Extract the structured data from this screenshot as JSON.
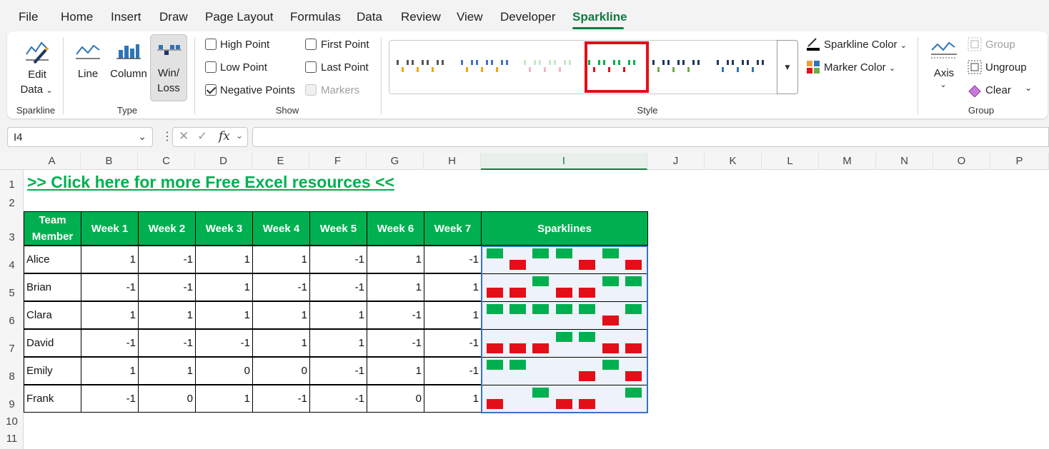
{
  "menu": {
    "tabs": [
      "File",
      "Home",
      "Insert",
      "Draw",
      "Page Layout",
      "Formulas",
      "Data",
      "Review",
      "View",
      "Developer",
      "Sparkline"
    ],
    "active": "Sparkline"
  },
  "ribbon": {
    "sparkline_group": {
      "label": "Sparkline",
      "edit_data_line1": "Edit",
      "edit_data_line2": "Data"
    },
    "type_group": {
      "label": "Type",
      "line": "Line",
      "column": "Column",
      "winloss_line1": "Win/",
      "winloss_line2": "Loss",
      "selected": "Win/Loss"
    },
    "show_group": {
      "label": "Show",
      "high_point": "High Point",
      "low_point": "Low Point",
      "negative_points": "Negative Points",
      "first_point": "First Point",
      "last_point": "Last Point",
      "markers": "Markers",
      "checked": {
        "high_point": false,
        "low_point": false,
        "negative_points": true,
        "first_point": false,
        "last_point": false,
        "markers": false
      }
    },
    "style_group": {
      "label": "Style",
      "sparkline_color": "Sparkline Color",
      "marker_color": "Marker Color",
      "swatches": [
        {
          "main": "#595959",
          "neg": "#f2a900"
        },
        {
          "main": "#4472c4",
          "neg": "#f2a900"
        },
        {
          "main": "#c6e8c6",
          "neg": "#f4b6c2"
        },
        {
          "main": "#00b050",
          "neg": "#e30f18"
        },
        {
          "main": "#1f3864",
          "neg": "#70ad47"
        },
        {
          "main": "#1f3864",
          "neg": "#2e75b6"
        }
      ],
      "selected_index": 3
    },
    "group_group": {
      "label": "Group",
      "axis": "Axis",
      "group": "Group",
      "ungroup": "Ungroup",
      "clear": "Clear"
    }
  },
  "formula_bar": {
    "name_box": "I4",
    "fx": "fx",
    "formula": ""
  },
  "sheet": {
    "columns": [
      "A",
      "B",
      "C",
      "D",
      "E",
      "F",
      "G",
      "H",
      "I",
      "J",
      "K",
      "L",
      "M",
      "N",
      "O",
      "P"
    ],
    "selected_column": "I",
    "rows": [
      "1",
      "2",
      "3",
      "4",
      "5",
      "6",
      "7",
      "8",
      "9",
      "10",
      "11"
    ],
    "link_text": ">> Click here for more Free Excel resources <<",
    "table": {
      "headers": [
        "Team Member",
        "Week 1",
        "Week 2",
        "Week 3",
        "Week 4",
        "Week 5",
        "Week 6",
        "Week 7",
        "Sparklines"
      ],
      "rows": [
        {
          "name": "Alice",
          "values": [
            1,
            -1,
            1,
            1,
            -1,
            1,
            -1
          ]
        },
        {
          "name": "Brian",
          "values": [
            -1,
            -1,
            1,
            -1,
            -1,
            1,
            1
          ]
        },
        {
          "name": "Clara",
          "values": [
            1,
            1,
            1,
            1,
            1,
            -1,
            1
          ]
        },
        {
          "name": "David",
          "values": [
            -1,
            -1,
            -1,
            1,
            1,
            -1,
            -1
          ]
        },
        {
          "name": "Emily",
          "values": [
            1,
            1,
            0,
            0,
            -1,
            1,
            -1
          ]
        },
        {
          "name": "Frank",
          "values": [
            -1,
            0,
            1,
            -1,
            -1,
            0,
            1
          ]
        }
      ]
    },
    "colors": {
      "header_green": "#00b050",
      "win": "#00b050",
      "loss": "#e30f18",
      "accent": "#107c41"
    }
  }
}
